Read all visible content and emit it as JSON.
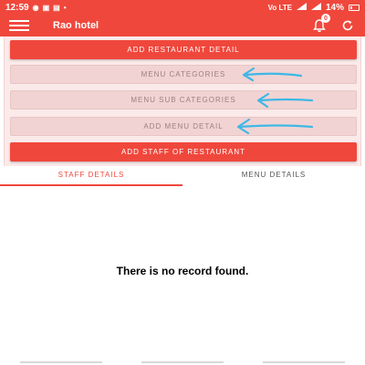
{
  "status_bar": {
    "time": "12:59",
    "left_icons": [
      "whatsapp-icon",
      "instagram-icon",
      "gallery-icon",
      "dot-icon"
    ],
    "network": "Vo LTE",
    "battery": "14%"
  },
  "app_bar": {
    "title": "Rao hotel",
    "notification_count": "0"
  },
  "menu": {
    "add_restaurant_detail": "ADD RESTAURANT DETAIL",
    "menu_categories": "MENU CATEGORIES",
    "menu_sub_categories": "MENU SUB CATEGORIES",
    "add_menu_detail": "ADD MENU DETAIL",
    "add_staff": "ADD STAFF OF RESTAURANT"
  },
  "tabs": [
    {
      "label": "STAFF DETAILS",
      "active": true
    },
    {
      "label": "MENU DETAILS",
      "active": false
    }
  ],
  "empty_message": "There is no record found.",
  "colors": {
    "accent": "#f0473c",
    "disabled_button": "#f1d3d3",
    "annotation_arrow": "#3db8e6"
  }
}
